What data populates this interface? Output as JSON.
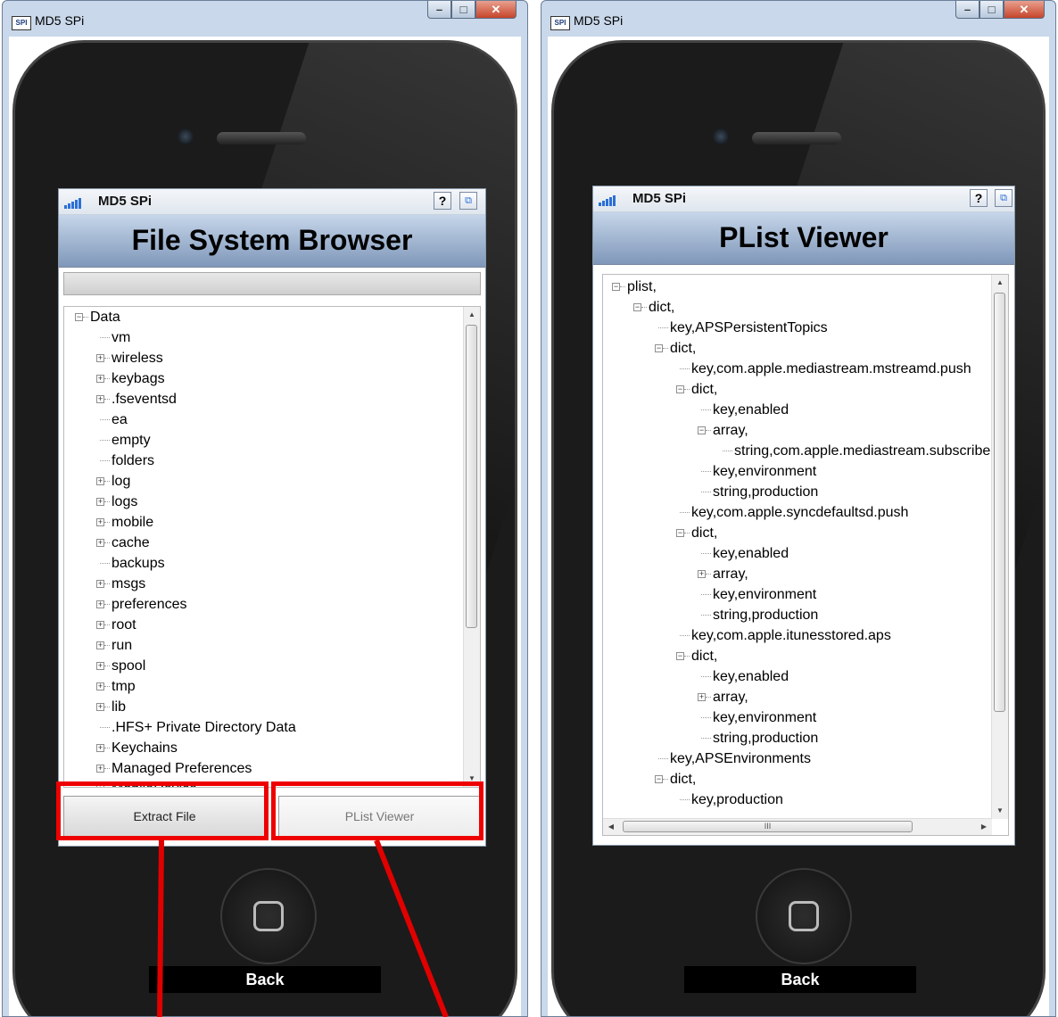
{
  "left_window": {
    "title": "MD5 SPi",
    "app_name": "MD5 SPi",
    "help_glyph": "?",
    "popout_glyph": "⧉",
    "banner": "File System Browser",
    "path_value": "",
    "tree": [
      {
        "label": "Data",
        "level": 0,
        "toggle": "minus"
      },
      {
        "label": "vm",
        "level": 1,
        "toggle": "none"
      },
      {
        "label": "wireless",
        "level": 1,
        "toggle": "plus"
      },
      {
        "label": "keybags",
        "level": 1,
        "toggle": "plus"
      },
      {
        "label": ".fseventsd",
        "level": 1,
        "toggle": "plus"
      },
      {
        "label": "ea",
        "level": 1,
        "toggle": "none"
      },
      {
        "label": "empty",
        "level": 1,
        "toggle": "none"
      },
      {
        "label": "folders",
        "level": 1,
        "toggle": "none"
      },
      {
        "label": "log",
        "level": 1,
        "toggle": "plus"
      },
      {
        "label": "logs",
        "level": 1,
        "toggle": "plus"
      },
      {
        "label": "mobile",
        "level": 1,
        "toggle": "plus"
      },
      {
        "label": "cache",
        "level": 1,
        "toggle": "plus"
      },
      {
        "label": "backups",
        "level": 1,
        "toggle": "none"
      },
      {
        "label": "msgs",
        "level": 1,
        "toggle": "plus"
      },
      {
        "label": "preferences",
        "level": 1,
        "toggle": "plus"
      },
      {
        "label": "root",
        "level": 1,
        "toggle": "plus"
      },
      {
        "label": "run",
        "level": 1,
        "toggle": "plus"
      },
      {
        "label": "spool",
        "level": 1,
        "toggle": "plus"
      },
      {
        "label": "tmp",
        "level": 1,
        "toggle": "plus"
      },
      {
        "label": "lib",
        "level": 1,
        "toggle": "plus"
      },
      {
        "label": ".HFS+ Private Directory Data",
        "level": 1,
        "toggle": "none"
      },
      {
        "label": "Keychains",
        "level": 1,
        "toggle": "plus"
      },
      {
        "label": "Managed Preferences",
        "level": 1,
        "toggle": "plus"
      },
      {
        "label": "MobileDevice",
        "level": 1,
        "toggle": "plus"
      }
    ],
    "extract_button": "Extract File",
    "plist_button": "PList Viewer",
    "back_label": "Back"
  },
  "right_window": {
    "title": "MD5 SPi",
    "app_name": "MD5 SPi",
    "help_glyph": "?",
    "popout_glyph": "⧉",
    "banner": "PList Viewer",
    "tree": [
      {
        "label": "plist,",
        "level": 0,
        "toggle": "minus"
      },
      {
        "label": "dict,",
        "level": 1,
        "toggle": "minus"
      },
      {
        "label": "key,APSPersistentTopics",
        "level": 2,
        "toggle": "none"
      },
      {
        "label": "dict,",
        "level": 2,
        "toggle": "minus"
      },
      {
        "label": "key,com.apple.mediastream.mstreamd.push",
        "level": 3,
        "toggle": "none"
      },
      {
        "label": "dict,",
        "level": 3,
        "toggle": "minus"
      },
      {
        "label": "key,enabled",
        "level": 4,
        "toggle": "none"
      },
      {
        "label": "array,",
        "level": 4,
        "toggle": "minus"
      },
      {
        "label": "string,com.apple.mediastream.subscriber",
        "level": 5,
        "toggle": "none"
      },
      {
        "label": "key,environment",
        "level": 4,
        "toggle": "none"
      },
      {
        "label": "string,production",
        "level": 4,
        "toggle": "none"
      },
      {
        "label": "key,com.apple.syncdefaultsd.push",
        "level": 3,
        "toggle": "none"
      },
      {
        "label": "dict,",
        "level": 3,
        "toggle": "minus"
      },
      {
        "label": "key,enabled",
        "level": 4,
        "toggle": "none"
      },
      {
        "label": "array,",
        "level": 4,
        "toggle": "plus"
      },
      {
        "label": "key,environment",
        "level": 4,
        "toggle": "none"
      },
      {
        "label": "string,production",
        "level": 4,
        "toggle": "none"
      },
      {
        "label": "key,com.apple.itunesstored.aps",
        "level": 3,
        "toggle": "none"
      },
      {
        "label": "dict,",
        "level": 3,
        "toggle": "minus"
      },
      {
        "label": "key,enabled",
        "level": 4,
        "toggle": "none"
      },
      {
        "label": "array,",
        "level": 4,
        "toggle": "plus"
      },
      {
        "label": "key,environment",
        "level": 4,
        "toggle": "none"
      },
      {
        "label": "string,production",
        "level": 4,
        "toggle": "none"
      },
      {
        "label": "key,APSEnvironments",
        "level": 2,
        "toggle": "none"
      },
      {
        "label": "dict,",
        "level": 2,
        "toggle": "minus"
      },
      {
        "label": "key,production",
        "level": 3,
        "toggle": "none"
      }
    ],
    "hscroll_grip": "III",
    "back_label": "Back"
  },
  "colors": {
    "annotation_red": "#e00000",
    "signal_blue": "#2b6fd6",
    "banner_top": "#c6d6ea",
    "banner_bottom": "#7f97b9"
  }
}
